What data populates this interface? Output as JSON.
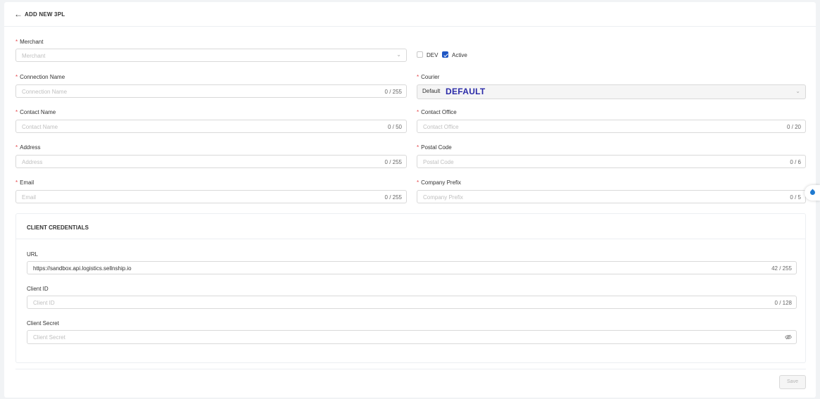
{
  "header": {
    "back_icon": "arrow-left-icon",
    "title": "ADD NEW 3PL"
  },
  "form": {
    "merchant": {
      "label": "Merchant",
      "placeholder": "Merchant"
    },
    "dev_checkbox": {
      "label": "DEV",
      "checked": false
    },
    "active_checkbox": {
      "label": "Active",
      "checked": true
    },
    "connection_name": {
      "label": "Connection Name",
      "placeholder": "Connection Name",
      "counter": "0 / 255"
    },
    "courier": {
      "label": "Courier",
      "value_prefix": "Default",
      "value_code": "DEFAULT"
    },
    "contact_name": {
      "label": "Contact Name",
      "placeholder": "Contact Name",
      "counter": "0 / 50"
    },
    "contact_office": {
      "label": "Contact Office",
      "placeholder": "Contact Office",
      "counter": "0 / 20"
    },
    "address": {
      "label": "Address",
      "placeholder": "Address",
      "counter": "0 / 255"
    },
    "postal_code": {
      "label": "Postal Code",
      "placeholder": "Postal Code",
      "counter": "0 / 6"
    },
    "email": {
      "label": "Email",
      "placeholder": "Email",
      "counter": "0 / 255"
    },
    "company_prefix": {
      "label": "Company Prefix",
      "placeholder": "Company Prefix",
      "counter": "0 / 5"
    }
  },
  "credentials": {
    "title": "CLIENT CREDENTIALS",
    "url": {
      "label": "URL",
      "value": "https://sandbox.api.logistics.sellnship.io",
      "counter": "42 / 255"
    },
    "client_id": {
      "label": "Client ID",
      "placeholder": "Client ID",
      "counter": "0 / 128"
    },
    "client_secret": {
      "label": "Client Secret",
      "placeholder": "Client Secret"
    }
  },
  "actions": {
    "save_label": "Save"
  },
  "colors": {
    "required": "#e5484d",
    "accent": "#1f56c4",
    "courier_code": "#2b2ba8"
  }
}
